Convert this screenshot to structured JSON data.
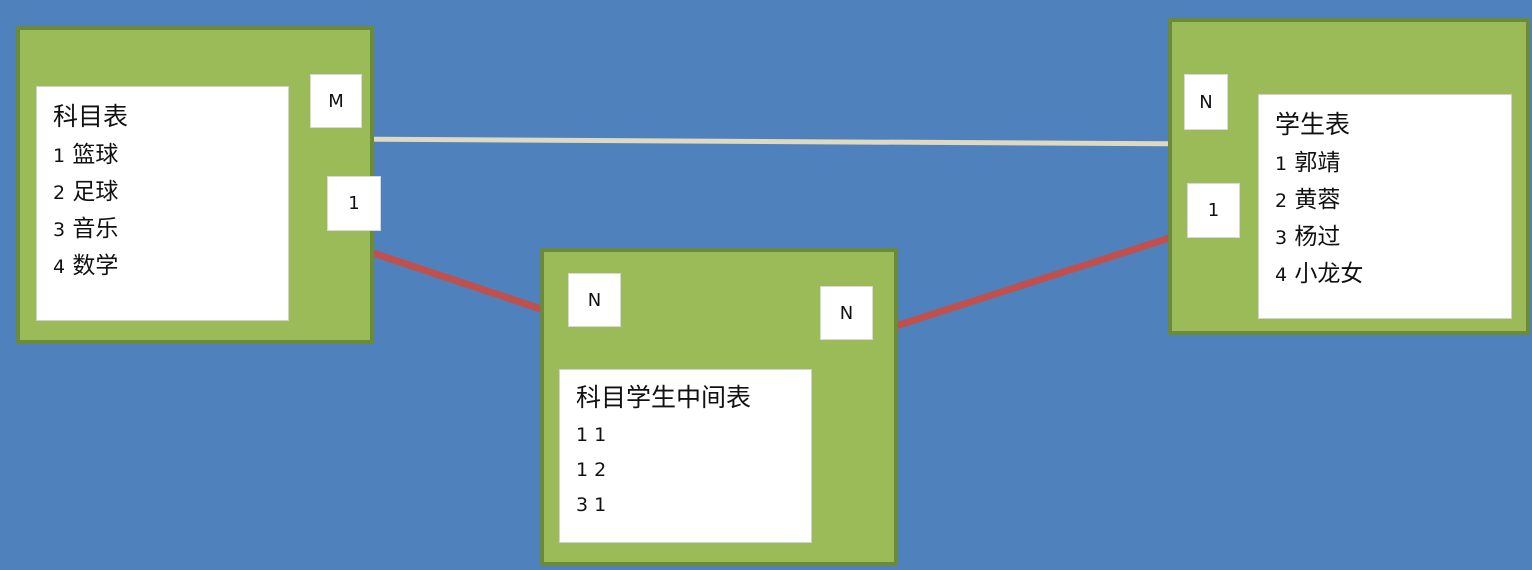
{
  "colors": {
    "background": "#4f81bd",
    "box_fill": "#9bbb59",
    "box_border": "#6b8a3a",
    "many_to_many_line": "#ddd9c3",
    "one_to_many_line": "#c0504d"
  },
  "tables": {
    "subject": {
      "title": "科目表",
      "rows": [
        {
          "id": "1",
          "name": "篮球"
        },
        {
          "id": "2",
          "name": "足球"
        },
        {
          "id": "3",
          "name": "音乐"
        },
        {
          "id": "4",
          "name": "数学"
        }
      ]
    },
    "student": {
      "title": "学生表",
      "rows": [
        {
          "id": "1",
          "name": "郭靖"
        },
        {
          "id": "2",
          "name": "黄蓉"
        },
        {
          "id": "3",
          "name": "杨过"
        },
        {
          "id": "4",
          "name": "小龙女"
        }
      ]
    },
    "middle": {
      "title": "科目学生中间表",
      "rows": [
        {
          "text": "1 1"
        },
        {
          "text": "1 2"
        },
        {
          "text": "3 1"
        }
      ]
    }
  },
  "cardinality": {
    "subject_m": "M",
    "student_n": "N",
    "subject_1": "1",
    "student_1": "1",
    "middle_n_left": "N",
    "middle_n_right": "N"
  }
}
